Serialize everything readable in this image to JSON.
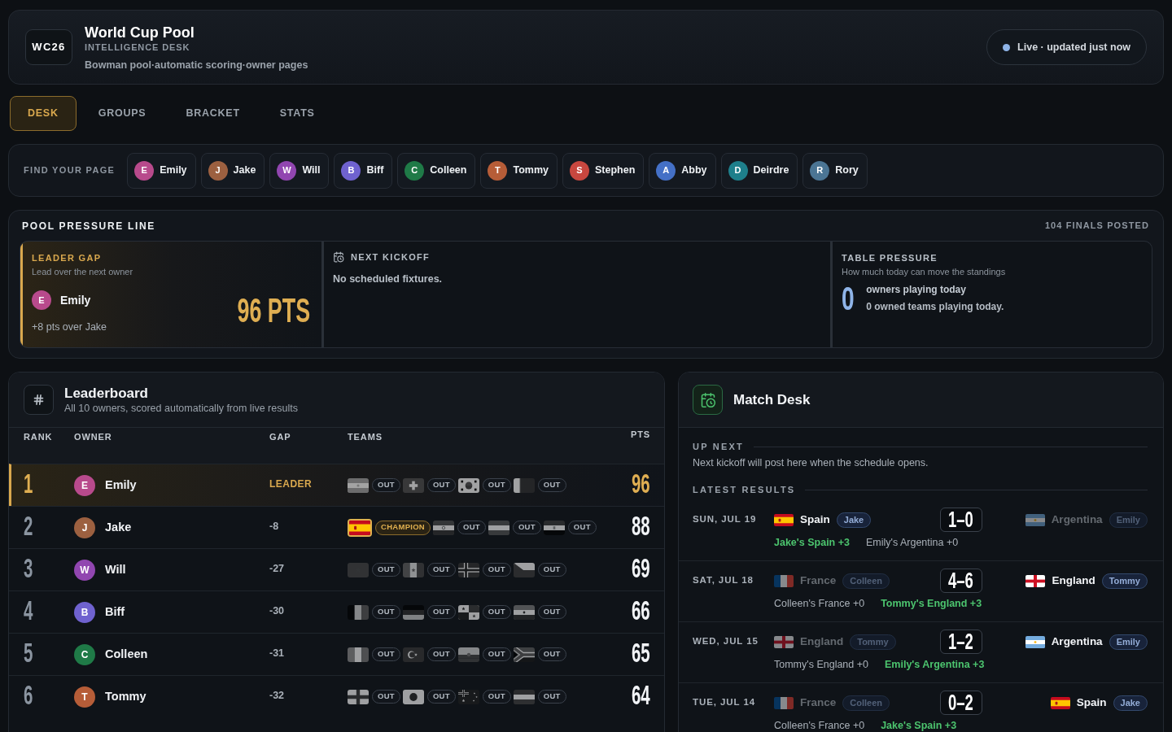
{
  "header": {
    "logo": "WC26",
    "title": "World Cup Pool",
    "subtitle": "INTELLIGENCE DESK",
    "tagline": "Bowman pool·automatic scoring·owner pages",
    "status": {
      "label": "Live · updated just now",
      "live": true
    }
  },
  "tabs": [
    {
      "label": "DESK",
      "selected": true
    },
    {
      "label": "GROUPS",
      "selected": false
    },
    {
      "label": "BRACKET",
      "selected": false
    },
    {
      "label": "STATS",
      "selected": false
    }
  ],
  "owner_finder": {
    "label": "FIND YOUR PAGE",
    "owners": [
      {
        "initial": "E",
        "name": "Emily",
        "color": "#b84a8c"
      },
      {
        "initial": "J",
        "name": "Jake",
        "color": "#9c6040"
      },
      {
        "initial": "W",
        "name": "Will",
        "color": "#9146b0"
      },
      {
        "initial": "B",
        "name": "Biff",
        "color": "#6f62cf"
      },
      {
        "initial": "C",
        "name": "Colleen",
        "color": "#1f7a47"
      },
      {
        "initial": "T",
        "name": "Tommy",
        "color": "#b65d38"
      },
      {
        "initial": "S",
        "name": "Stephen",
        "color": "#c8473f"
      },
      {
        "initial": "A",
        "name": "Abby",
        "color": "#4470c6"
      },
      {
        "initial": "D",
        "name": "Deirdre",
        "color": "#1e7f8b"
      },
      {
        "initial": "R",
        "name": "Rory",
        "color": "#4b7594"
      }
    ]
  },
  "pressure_line": {
    "title": "POOL PRESSURE LINE",
    "finals_posted": "104 FINALS POSTED",
    "leader_gap": {
      "title": "LEADER GAP",
      "subtitle": "Lead over the next owner",
      "owner": {
        "initial": "E",
        "name": "Emily",
        "color": "#b84a8c"
      },
      "points": "96 PTS",
      "note": "+8 pts over Jake"
    },
    "next_kickoff": {
      "title": "NEXT KICKOFF",
      "message": "No scheduled fixtures."
    },
    "table_pressure": {
      "title": "TABLE PRESSURE",
      "subtitle": "How much today can move the standings",
      "count": "0",
      "label": "owners playing today",
      "note": "0 owned teams playing today."
    }
  },
  "leaderboard": {
    "title": "Leaderboard",
    "subtitle": "All 10 owners, scored automatically from live results",
    "columns": [
      "RANK",
      "OWNER",
      "GAP",
      "TEAMS",
      "PTS"
    ],
    "rows": [
      {
        "rank": "1",
        "initial": "E",
        "name": "Emily",
        "color": "#b84a8c",
        "leader": true,
        "gap": "LEADER",
        "teams": [
          {
            "kind": "out",
            "label": "OUT"
          },
          {
            "kind": "out",
            "label": "OUT"
          },
          {
            "kind": "out",
            "label": "OUT"
          },
          {
            "kind": "out",
            "label": "OUT"
          }
        ],
        "pts": "96"
      },
      {
        "rank": "2",
        "initial": "J",
        "name": "Jake",
        "color": "#9c6040",
        "leader": false,
        "gap": "-8",
        "teams": [
          {
            "kind": "champion",
            "label": "CHAMPION"
          },
          {
            "kind": "out",
            "label": "OUT"
          },
          {
            "kind": "out",
            "label": "OUT"
          },
          {
            "kind": "out",
            "label": "OUT"
          }
        ],
        "pts": "88"
      },
      {
        "rank": "3",
        "initial": "W",
        "name": "Will",
        "color": "#9146b0",
        "leader": false,
        "gap": "-27",
        "teams": [
          {
            "kind": "out",
            "label": "OUT"
          },
          {
            "kind": "out",
            "label": "OUT"
          },
          {
            "kind": "out",
            "label": "OUT"
          },
          {
            "kind": "out",
            "label": "OUT"
          }
        ],
        "pts": "69"
      },
      {
        "rank": "4",
        "initial": "B",
        "name": "Biff",
        "color": "#6f62cf",
        "leader": false,
        "gap": "-30",
        "teams": [
          {
            "kind": "out",
            "label": "OUT"
          },
          {
            "kind": "out",
            "label": "OUT"
          },
          {
            "kind": "out",
            "label": "OUT"
          },
          {
            "kind": "out",
            "label": "OUT"
          }
        ],
        "pts": "66"
      },
      {
        "rank": "5",
        "initial": "C",
        "name": "Colleen",
        "color": "#1f7a47",
        "leader": false,
        "gap": "-31",
        "teams": [
          {
            "kind": "out",
            "label": "OUT"
          },
          {
            "kind": "out",
            "label": "OUT"
          },
          {
            "kind": "out",
            "label": "OUT"
          },
          {
            "kind": "out",
            "label": "OUT"
          }
        ],
        "pts": "65"
      },
      {
        "rank": "6",
        "initial": "T",
        "name": "Tommy",
        "color": "#b65d38",
        "leader": false,
        "gap": "-32",
        "teams": [
          {
            "kind": "out",
            "label": "OUT"
          },
          {
            "kind": "out",
            "label": "OUT"
          },
          {
            "kind": "out",
            "label": "OUT"
          },
          {
            "kind": "out",
            "label": "OUT"
          }
        ],
        "pts": "64"
      }
    ]
  },
  "match_desk": {
    "title": "Match Desk",
    "up_next": {
      "title": "UP NEXT",
      "message": "Next kickoff will post here when the schedule opens."
    },
    "results_title": "LATEST RESULTS",
    "results": [
      {
        "date": "SUN, JUL 19",
        "home": {
          "team": "Spain",
          "owner": "Jake",
          "won": true
        },
        "score": "1–0",
        "away": {
          "team": "Argentina",
          "owner": "Emily",
          "won": false
        },
        "points": [
          {
            "text": "Jake's Spain +3",
            "scored": true
          },
          {
            "text": "Emily's Argentina +0",
            "scored": false
          }
        ]
      },
      {
        "date": "SAT, JUL 18",
        "home": {
          "team": "France",
          "owner": "Colleen",
          "won": false
        },
        "score": "4–6",
        "away": {
          "team": "England",
          "owner": "Tommy",
          "won": true
        },
        "points": [
          {
            "text": "Colleen's France +0",
            "scored": false
          },
          {
            "text": "Tommy's England +3",
            "scored": true
          }
        ]
      },
      {
        "date": "WED, JUL 15",
        "home": {
          "team": "England",
          "owner": "Tommy",
          "won": false
        },
        "score": "1–2",
        "away": {
          "team": "Argentina",
          "owner": "Emily",
          "won": true
        },
        "points": [
          {
            "text": "Tommy's England +0",
            "scored": false
          },
          {
            "text": "Emily's Argentina +3",
            "scored": true
          }
        ]
      },
      {
        "date": "TUE, JUL 14",
        "home": {
          "team": "France",
          "owner": "Colleen",
          "won": false
        },
        "score": "0–2",
        "away": {
          "team": "Spain",
          "owner": "Jake",
          "won": true
        },
        "points": [
          {
            "text": "Colleen's France +0",
            "scored": false
          },
          {
            "text": "Jake's Spain +3",
            "scored": true
          }
        ]
      }
    ]
  }
}
